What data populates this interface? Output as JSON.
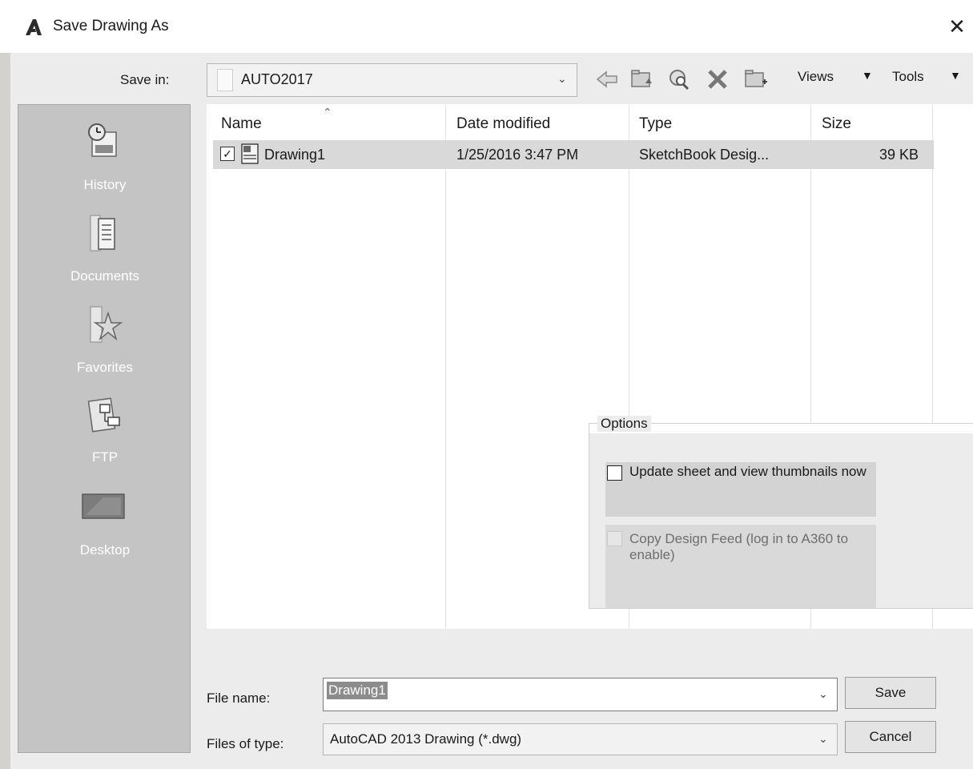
{
  "window": {
    "title": "Save Drawing As",
    "close_glyph": "✕"
  },
  "toolbar": {
    "save_in_label": "Save in:",
    "save_in_value": "AUTO2017",
    "views_label": "Views",
    "tools_label": "Tools",
    "icons": [
      "back-icon",
      "up-folder-icon",
      "search-web-icon",
      "delete-icon",
      "new-folder-icon"
    ]
  },
  "places": [
    {
      "label": "History",
      "icon": "history-icon"
    },
    {
      "label": "Documents",
      "icon": "documents-icon"
    },
    {
      "label": "Favorites",
      "icon": "favorites-icon"
    },
    {
      "label": "FTP",
      "icon": "ftp-icon"
    },
    {
      "label": "Desktop",
      "icon": "desktop-icon"
    }
  ],
  "file_list": {
    "columns": [
      "Name",
      "Date modified",
      "Type",
      "Size"
    ],
    "rows": [
      {
        "name": "Drawing1",
        "date": "1/25/2016 3:47 PM",
        "type": "SketchBook Desig...",
        "size": "39 KB",
        "checked": true
      }
    ]
  },
  "options": {
    "legend": "Options",
    "update_thumbnails_label": "Update sheet and view thumbnails now",
    "update_thumbnails_checked": false,
    "copy_design_feed_label": "Copy Design Feed (log in to A360 to enable)",
    "copy_design_feed_enabled": false
  },
  "bottom": {
    "file_name_label": "File name:",
    "file_name_value": "Drawing1",
    "file_type_label": "Files of type:",
    "file_type_value": "AutoCAD 2013 Drawing (*.dwg)",
    "save_label": "Save",
    "cancel_label": "Cancel"
  }
}
